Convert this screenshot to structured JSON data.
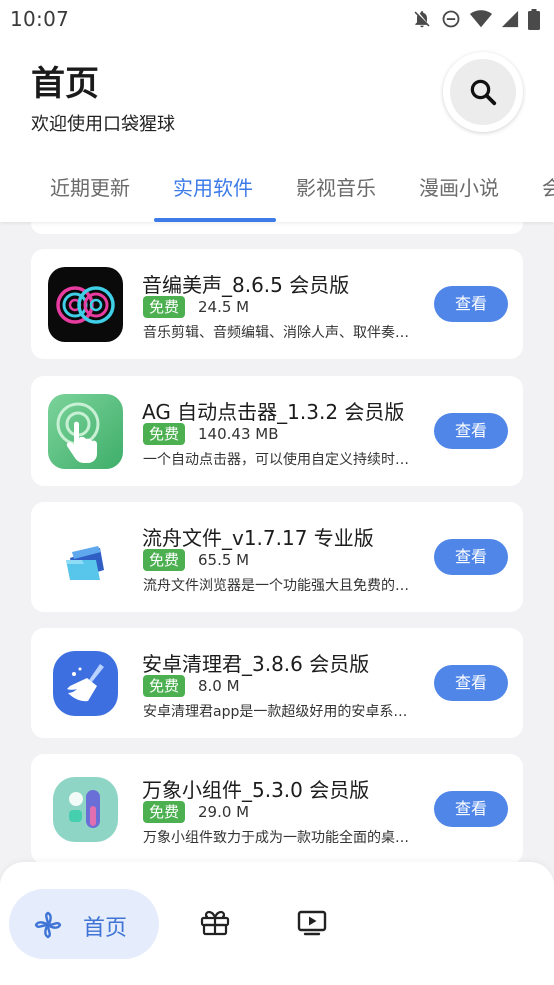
{
  "status_bar": {
    "time": "10:07"
  },
  "header": {
    "title": "首页",
    "subtitle": "欢迎使用口袋猩球",
    "tabs": [
      "近期更新",
      "实用软件",
      "影视音乐",
      "漫画小说",
      "会"
    ],
    "active_tab": "实用软件"
  },
  "apps": [
    {
      "name": "音编美声_8.6.5 会员版",
      "badge": "免费",
      "size": "24.5 M",
      "desc": "音乐剪辑、音频编辑、消除人声、取伴奏…",
      "action": "查看",
      "icon": "audio-waves-icon"
    },
    {
      "name": "AG 自动点击器_1.3.2 会员版",
      "badge": "免费",
      "size": "140.43 MB",
      "desc": "一个自动点击器，可以使用自定义持续时…",
      "action": "查看",
      "icon": "tap-hand-icon"
    },
    {
      "name": "流舟文件_v1.7.17 专业版",
      "badge": "免费",
      "size": "65.5 M",
      "desc": "流舟文件浏览器是一个功能强大且免费的…",
      "action": "查看",
      "icon": "folder-icon"
    },
    {
      "name": "安卓清理君_3.8.6 会员版",
      "badge": "免费",
      "size": "8.0 M",
      "desc": "安卓清理君app是一款超级好用的安卓系…",
      "action": "查看",
      "icon": "broom-icon"
    },
    {
      "name": "万象小组件_5.3.0 会员版",
      "badge": "免费",
      "size": "29.0 M",
      "desc": "万象小组件致力于成为一款功能全面的桌…",
      "action": "查看",
      "icon": "widget-icon"
    }
  ],
  "bottom_nav": {
    "home_label": "首页"
  },
  "colors": {
    "accent": "#3d7be8",
    "button": "#4f86e8",
    "badge": "#4caf50"
  }
}
